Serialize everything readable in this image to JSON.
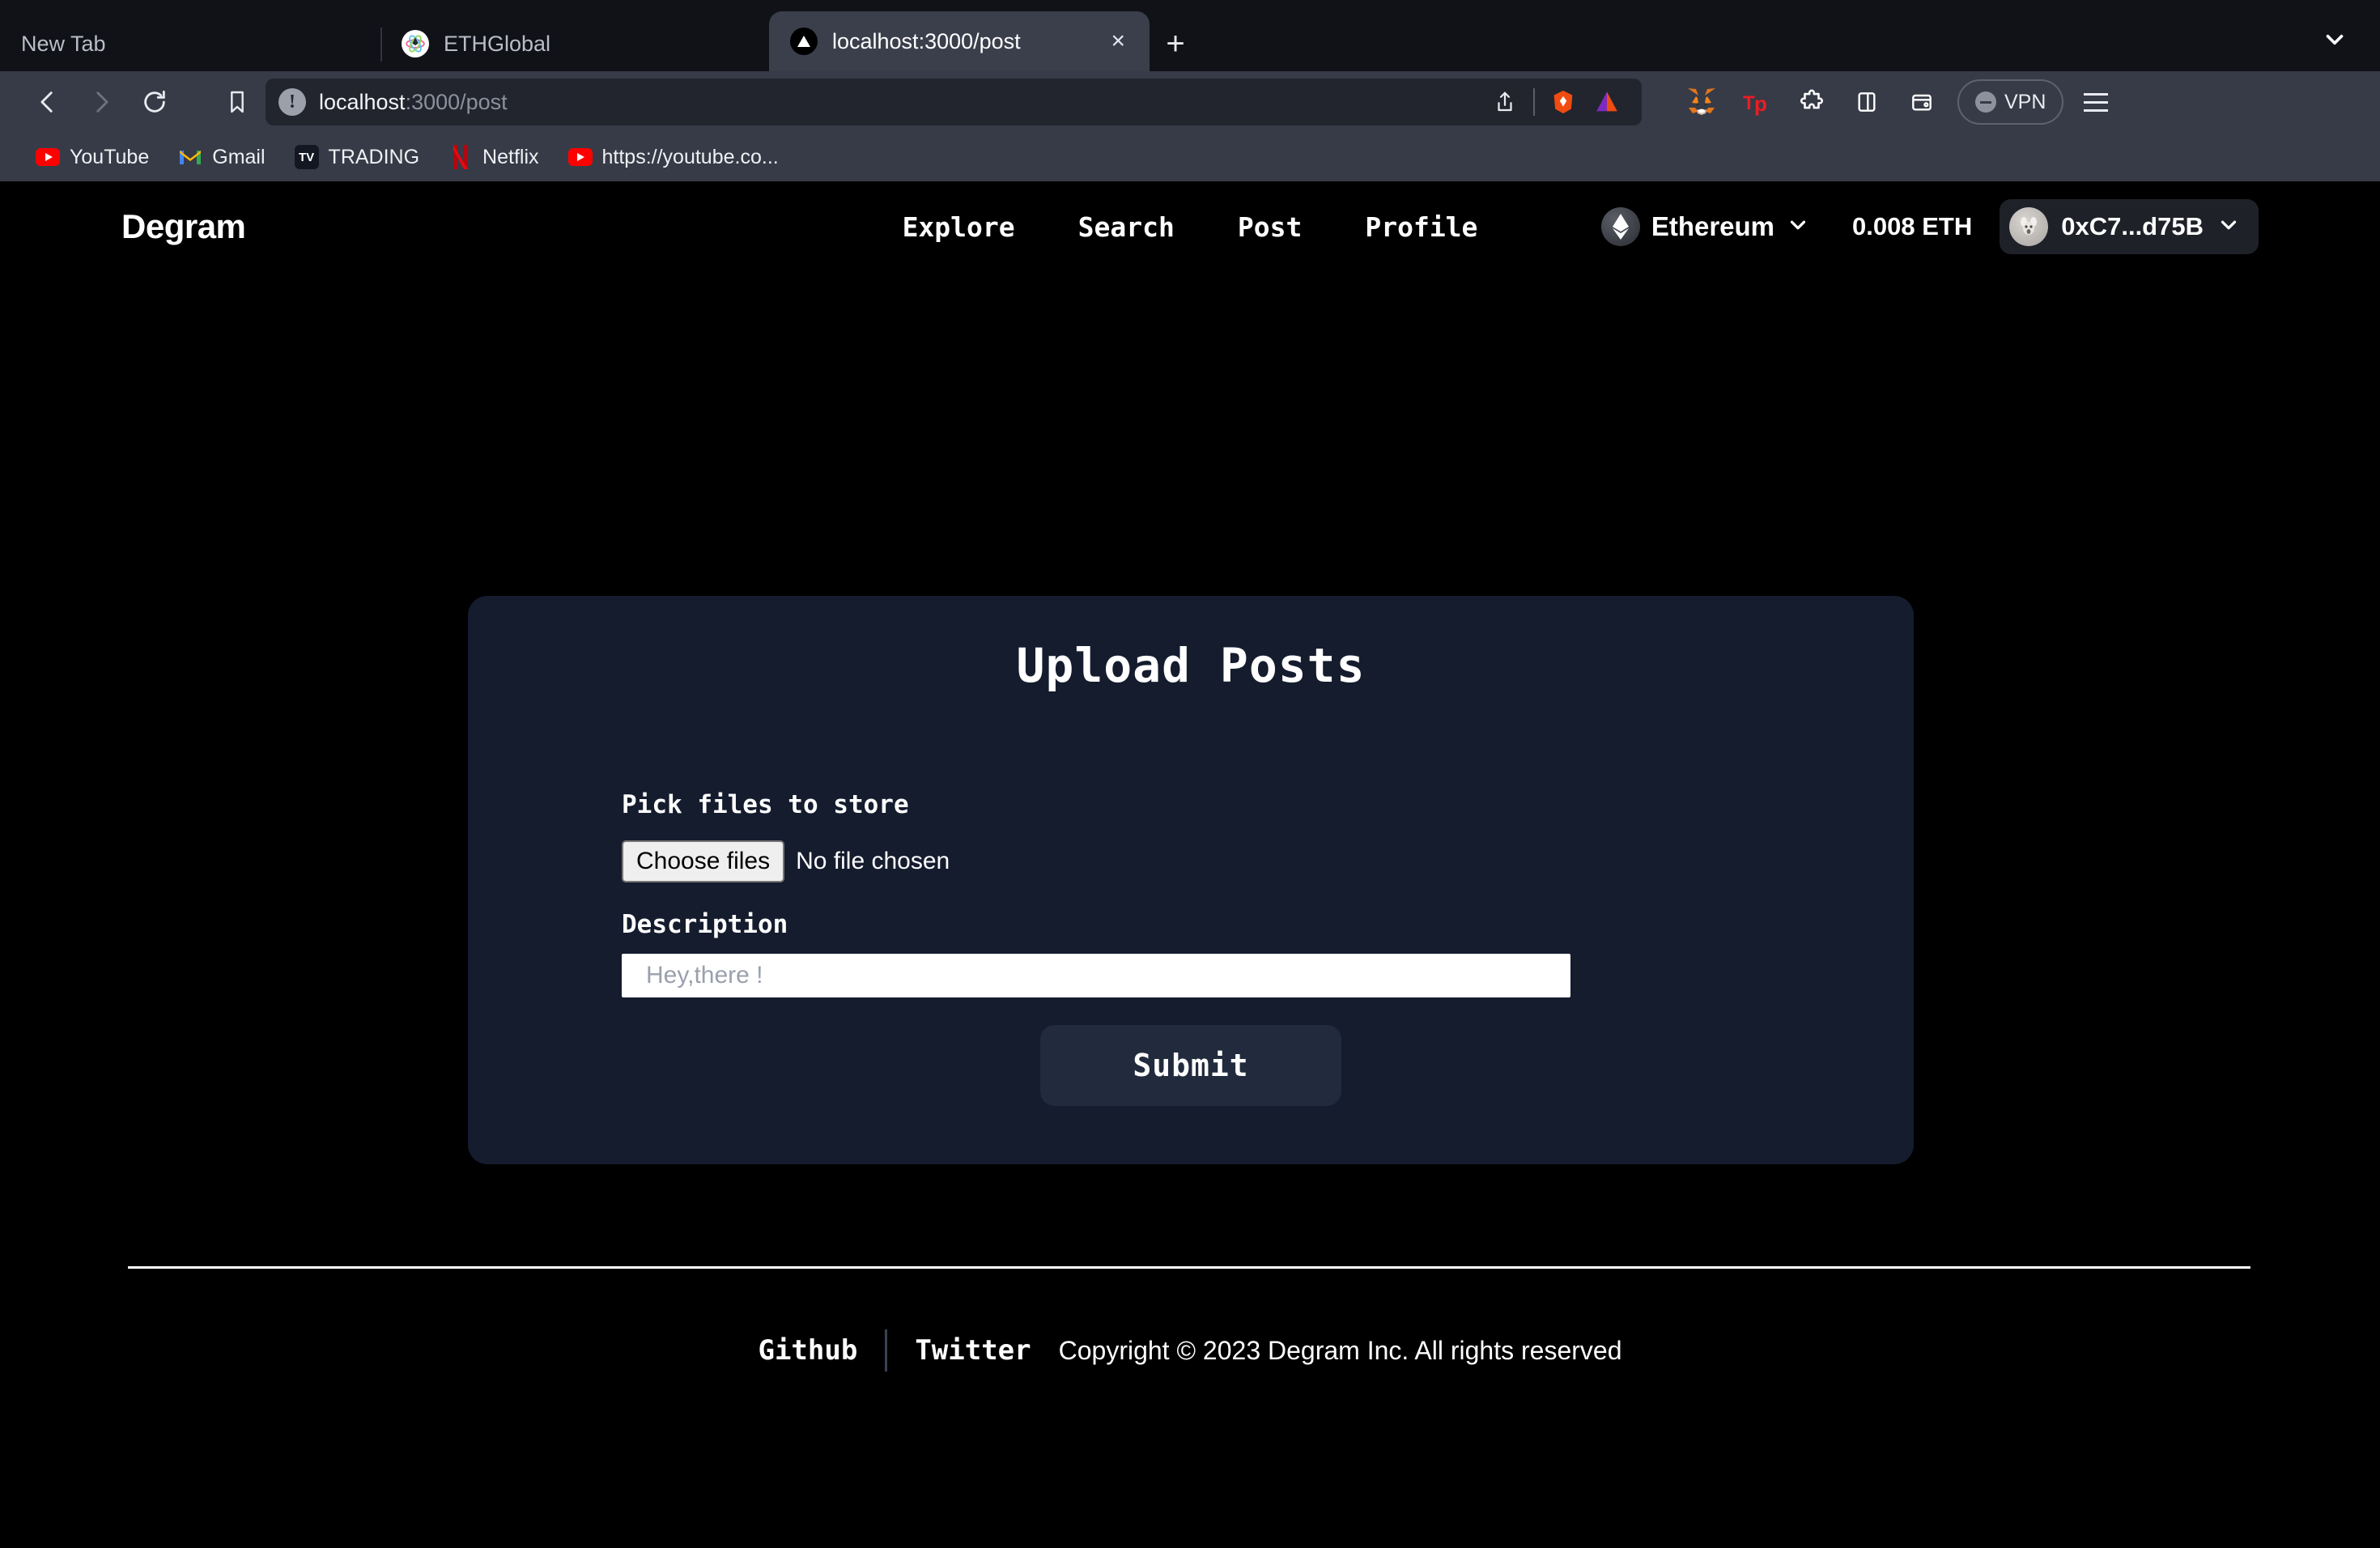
{
  "browser": {
    "tabs": [
      {
        "title": "New Tab",
        "favicon": "none",
        "active": false
      },
      {
        "title": "ETHGlobal",
        "favicon": "ethglobal-icon",
        "active": false
      },
      {
        "title": "localhost:3000/post",
        "favicon": "vercel-icon",
        "active": true
      }
    ],
    "new_tab_button": "+",
    "tab_close_label": "×",
    "tab_search_icon": "chevron-down-icon",
    "toolbar": {
      "back_icon": "back-arrow-icon",
      "forward_icon": "forward-arrow-icon",
      "reload_icon": "reload-icon",
      "bookmark_icon": "bookmark-icon",
      "url_host": "localhost",
      "url_path": ":3000/post",
      "site_info_icon": "info-icon",
      "share_icon": "share-icon",
      "brave_icon": "brave-lion-icon",
      "bat_icon": "bat-triangle-icon",
      "extensions": [
        "metamask-fox-icon",
        "tp-wallet-icon",
        "puzzle-piece-icon",
        "sidebar-panel-icon",
        "wallet-card-icon"
      ],
      "vpn_label": "VPN",
      "menu_icon": "hamburger-menu-icon"
    },
    "bookmarks": [
      {
        "label": "YouTube",
        "icon": "youtube-icon"
      },
      {
        "label": "Gmail",
        "icon": "gmail-icon"
      },
      {
        "label": "TRADING",
        "icon": "tradingview-icon"
      },
      {
        "label": "Netflix",
        "icon": "netflix-icon"
      },
      {
        "label": "https://youtube.co...",
        "icon": "youtube-icon"
      }
    ]
  },
  "app": {
    "brand": "Degram",
    "nav": [
      {
        "label": "Explore"
      },
      {
        "label": "Search"
      },
      {
        "label": "Post"
      },
      {
        "label": "Profile"
      }
    ],
    "wallet": {
      "chain": "Ethereum",
      "chain_icon": "ethereum-diamond-icon",
      "chain_chevron": "chevron-down-icon",
      "balance": "0.008 ETH",
      "account": "0xC7...d75B",
      "account_avatar": "account-blockie-icon",
      "account_chevron": "chevron-down-icon"
    },
    "card": {
      "title": "Upload Posts",
      "file_label": "Pick files to store",
      "choose_button": "Choose files",
      "no_file_text": "No file chosen",
      "description_label": "Description",
      "description_value": "",
      "description_placeholder": "Hey,there !",
      "submit_label": "Submit"
    },
    "footer": {
      "github": "Github",
      "twitter": "Twitter",
      "copyright": "Copyright © 2023 Degram Inc. All rights reserved"
    }
  },
  "colors": {
    "page_bg": "#000000",
    "card_bg": "#141c2e",
    "submit_bg": "#222b3d",
    "toolbar_bg": "#373b47",
    "tabstrip_bg": "#101218",
    "accent_white": "#ffffff"
  }
}
